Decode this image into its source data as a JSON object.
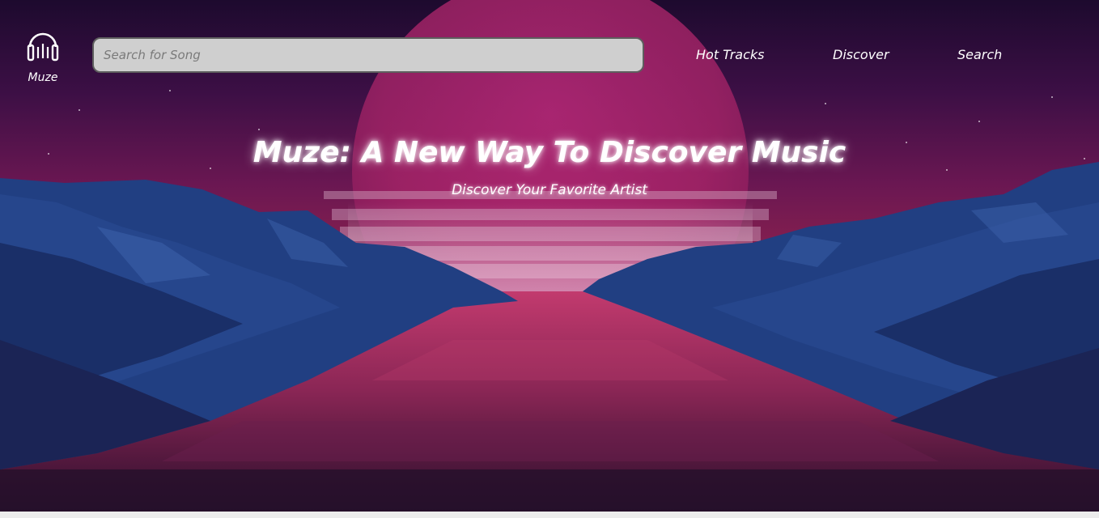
{
  "header": {
    "logo": {
      "icon": "headphones-icon",
      "text": "Muze"
    },
    "search": {
      "placeholder": "Search for Song",
      "value": ""
    },
    "nav": [
      {
        "label": "Hot Tracks"
      },
      {
        "label": "Discover"
      },
      {
        "label": "Search"
      }
    ]
  },
  "hero": {
    "title": "Muze: A New Way To Discover Music",
    "subtitle": "Discover Your Favorite Artist"
  },
  "colors": {
    "sky_top": "#1d0a2e",
    "sun": "#b0236e",
    "mountain_blue": "#1f3f86",
    "ground_pink": "#a8305f",
    "search_bg": "#cfcfcf",
    "text": "#ffffff"
  }
}
